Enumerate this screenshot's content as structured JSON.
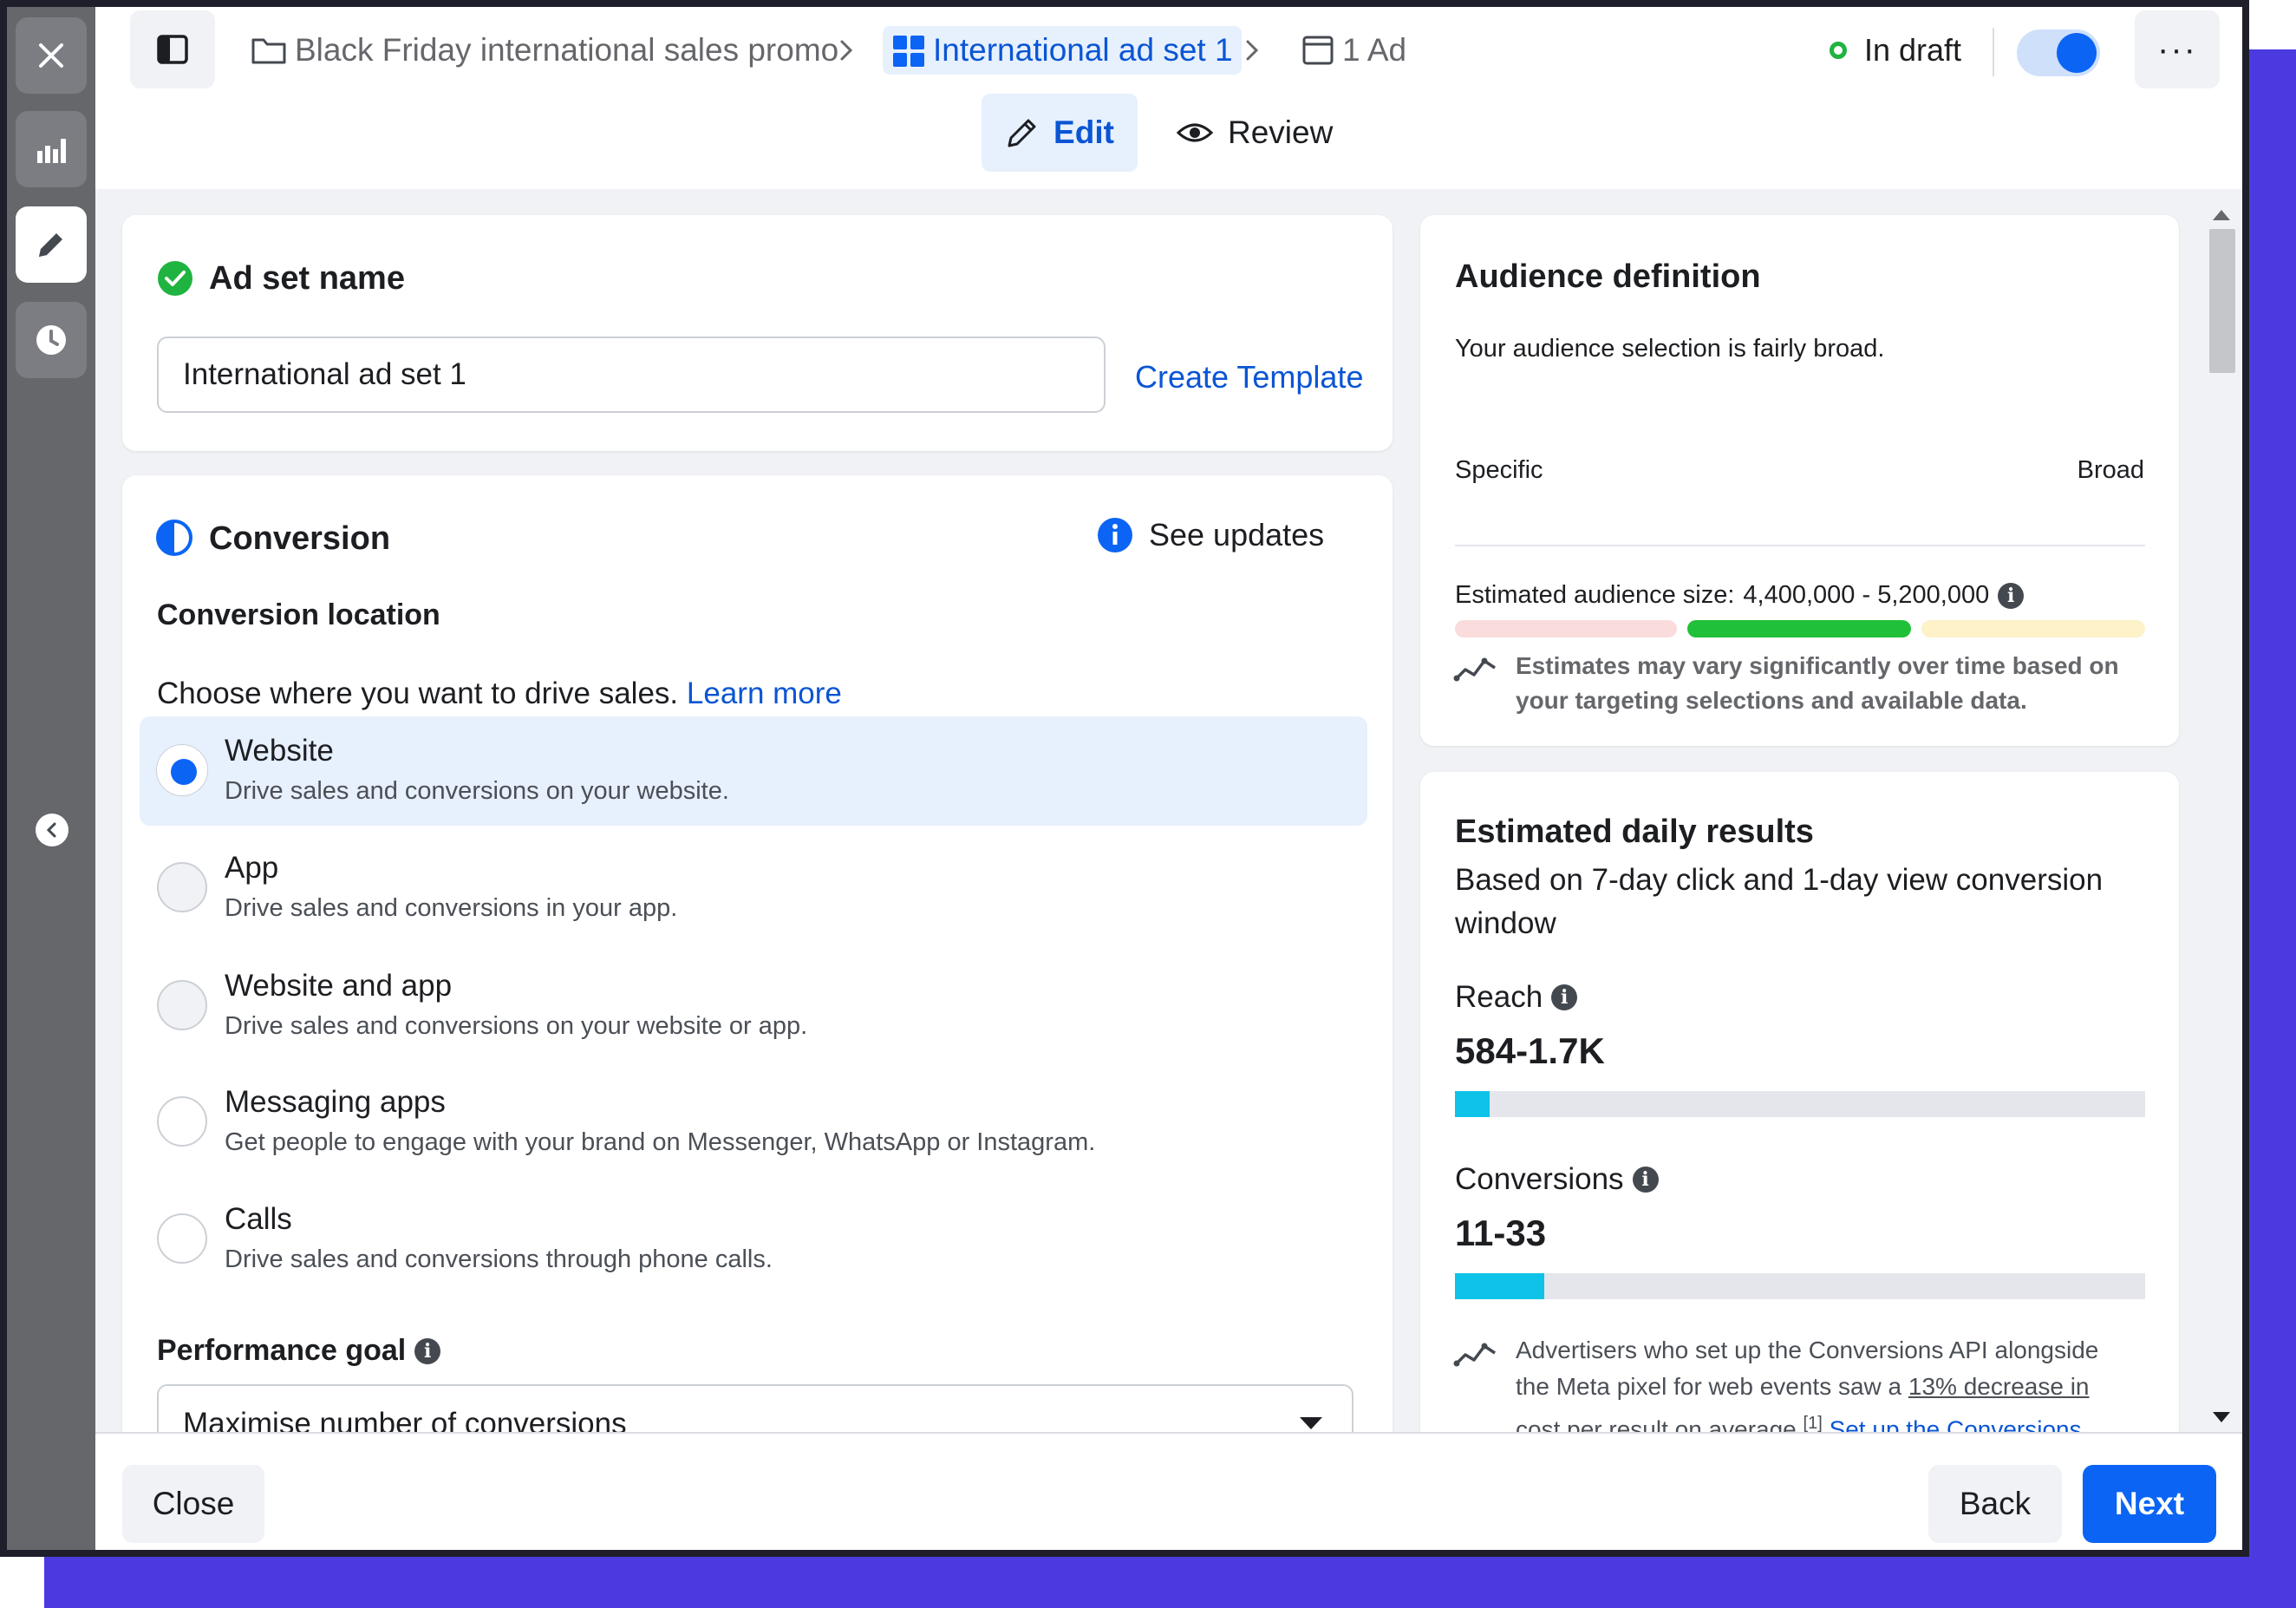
{
  "header": {
    "breadcrumbs": [
      {
        "label": "Black Friday international sales promo"
      },
      {
        "label": "International ad set 1"
      },
      {
        "label": "1 Ad"
      }
    ],
    "status": "In draft",
    "more_label": "···",
    "tabs": [
      {
        "label": "Edit"
      },
      {
        "label": "Review"
      }
    ]
  },
  "ad_set_name": {
    "title": "Ad set name",
    "value": "International ad set 1",
    "create_template": "Create Template"
  },
  "conversion": {
    "title": "Conversion",
    "see_updates": "See updates",
    "location_title": "Conversion location",
    "choose_text": "Choose where you want to drive sales.",
    "learn_more": "Learn more",
    "options": [
      {
        "label": "Website",
        "desc": "Drive sales and conversions on your website."
      },
      {
        "label": "App",
        "desc": "Drive sales and conversions in your app."
      },
      {
        "label": "Website and app",
        "desc": "Drive sales and conversions on your website or app."
      },
      {
        "label": "Messaging apps",
        "desc": "Get people to engage with your brand on Messenger, WhatsApp or Instagram."
      },
      {
        "label": "Calls",
        "desc": "Drive sales and conversions through phone calls."
      }
    ],
    "selected_index": 0,
    "performance_goal_title": "Performance goal",
    "performance_goal_value": "Maximise number of conversions"
  },
  "audience": {
    "title": "Audience definition",
    "summary": "Your audience selection is fairly broad.",
    "meter_colors": [
      "#fbdcdc",
      "#20c038",
      "#fdf2c8"
    ],
    "meter_active_index": 1,
    "specific_label": "Specific",
    "broad_label": "Broad",
    "size_label": "Estimated audience size:",
    "size_value": "4,400,000 - 5,200,000",
    "note_line1": "Estimates may vary significantly over time based on",
    "note_line2": "your targeting selections and available data."
  },
  "daily_results": {
    "title": "Estimated daily results",
    "subtitle_line1": "Based on 7-day click and 1-day view conversion",
    "subtitle_line2": "window",
    "reach_label": "Reach",
    "reach_value": "584-1.7K",
    "reach_fill_fraction": 0.05,
    "conversions_label": "Conversions",
    "conversions_value": "11-33",
    "conversions_fill_fraction": 0.13,
    "note_line1": "Advertisers who set up the Conversions API alongside",
    "note_line2_pre": "the Meta pixel for web events saw a ",
    "note_line2_link": "13% decrease in",
    "note_line3_link": "cost per result on average",
    "note_line3_ref": "[1]",
    "note_line3_cta": "Set up the Conversions"
  },
  "footer": {
    "close": "Close",
    "back": "Back",
    "next": "Next"
  },
  "colors": {
    "accent": "#0b64f4",
    "success": "#1fb340",
    "bar": "#0fc2e8",
    "frame_purple": "#4a3ae0"
  }
}
